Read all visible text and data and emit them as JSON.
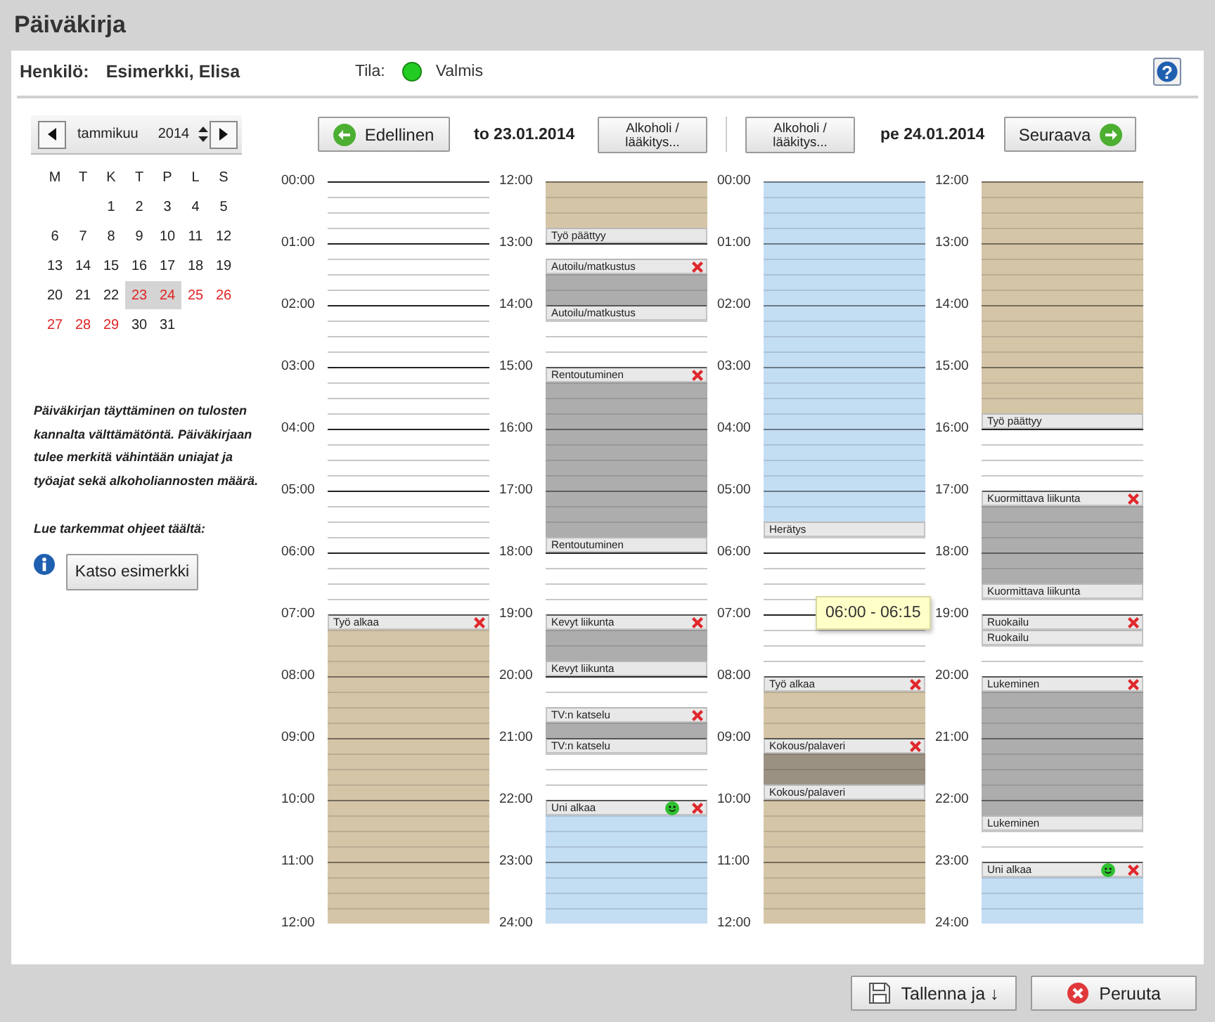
{
  "window": {
    "title": "Päiväkirja"
  },
  "header": {
    "person_label": "Henkilö:",
    "person": "Esimerkki, Elisa",
    "status": {
      "label": "Tila:",
      "color": "#22cc22",
      "value": "Valmis"
    },
    "help": "?"
  },
  "month_picker": {
    "month": "tammikuu",
    "year": "2014"
  },
  "calendar": {
    "weekdays": [
      "M",
      "T",
      "K",
      "T",
      "P",
      "L",
      "S"
    ],
    "weeks": [
      [
        {
          "day": "1",
          "selected": false,
          "marked": false
        },
        {
          "day": "2",
          "selected": false,
          "marked": false
        },
        {
          "day": "3",
          "selected": false,
          "marked": false
        },
        {
          "day": "4",
          "selected": false,
          "marked": false
        },
        {
          "day": "5",
          "selected": false,
          "marked": false
        }
      ],
      [
        {
          "day": "6",
          "selected": false,
          "marked": false
        },
        {
          "day": "7",
          "selected": false,
          "marked": false
        },
        {
          "day": "8",
          "selected": false,
          "marked": false
        },
        {
          "day": "9",
          "selected": false,
          "marked": false
        },
        {
          "day": "10",
          "selected": false,
          "marked": false
        },
        {
          "day": "11",
          "selected": false,
          "marked": false
        },
        {
          "day": "12",
          "selected": false,
          "marked": false
        }
      ],
      [
        {
          "day": "13",
          "selected": false,
          "marked": false
        },
        {
          "day": "14",
          "selected": false,
          "marked": false
        },
        {
          "day": "15",
          "selected": false,
          "marked": false
        },
        {
          "day": "16",
          "selected": false,
          "marked": false
        },
        {
          "day": "17",
          "selected": false,
          "marked": false
        },
        {
          "day": "18",
          "selected": false,
          "marked": false
        },
        {
          "day": "19",
          "selected": false,
          "marked": false
        }
      ],
      [
        {
          "day": "20",
          "selected": false,
          "marked": false
        },
        {
          "day": "21",
          "selected": false,
          "marked": false
        },
        {
          "day": "22",
          "selected": false,
          "marked": false
        },
        {
          "day": "23",
          "selected": true,
          "marked": true
        },
        {
          "day": "24",
          "selected": true,
          "marked": true
        },
        {
          "day": "25",
          "selected": false,
          "marked": true
        },
        {
          "day": "26",
          "selected": false,
          "marked": true
        }
      ],
      [
        {
          "day": "27",
          "selected": false,
          "marked": true
        },
        {
          "day": "28",
          "selected": false,
          "marked": true
        },
        {
          "day": "29",
          "selected": false,
          "marked": true
        },
        {
          "day": "30",
          "selected": false,
          "marked": false
        },
        {
          "day": "31",
          "selected": false,
          "marked": false
        }
      ]
    ]
  },
  "instructions": {
    "text": "Päiväkirjan täyttäminen on tulosten kannalta välttämätöntä. Päiväkirjaan tulee merkitä vähintään uniajat ja työajat sekä alkoholiannosten määrä.",
    "link_prompt": "Lue tarkemmat ohjeet täältä:",
    "example_button": "Katso esimerkki"
  },
  "nav": {
    "prev": "Edellinen",
    "next": "Seuraava"
  },
  "days": [
    {
      "date": "to 23.01.2014",
      "alcohol_button": "Alkoholi / lääkitys...",
      "columns": [
        {
          "hours": [
            "00:00",
            "01:00",
            "02:00",
            "03:00",
            "04:00",
            "05:00",
            "06:00",
            "07:00",
            "08:00",
            "09:00",
            "10:00",
            "11:00",
            "12:00"
          ],
          "slots": [
            {
              "kind": "empty"
            },
            {
              "kind": "empty"
            },
            {
              "kind": "empty"
            },
            {
              "kind": "empty"
            },
            {
              "kind": "empty"
            },
            {
              "kind": "empty"
            },
            {
              "kind": "empty"
            },
            {
              "kind": "empty"
            },
            {
              "kind": "empty"
            },
            {
              "kind": "empty"
            },
            {
              "kind": "empty"
            },
            {
              "kind": "empty"
            },
            {
              "kind": "empty"
            },
            {
              "kind": "empty"
            },
            {
              "kind": "empty"
            },
            {
              "kind": "empty"
            },
            {
              "kind": "empty"
            },
            {
              "kind": "empty"
            },
            {
              "kind": "empty"
            },
            {
              "kind": "empty"
            },
            {
              "kind": "empty"
            },
            {
              "kind": "empty"
            },
            {
              "kind": "empty"
            },
            {
              "kind": "empty"
            },
            {
              "kind": "empty"
            },
            {
              "kind": "empty"
            },
            {
              "kind": "empty"
            },
            {
              "kind": "empty"
            },
            {
              "kind": "label",
              "text": "Työ alkaa",
              "delete": true,
              "smiley": false
            },
            {
              "kind": "fill",
              "color": "#d5c5a7"
            },
            {
              "kind": "fill",
              "color": "#d5c5a7"
            },
            {
              "kind": "fill",
              "color": "#d5c5a7"
            },
            {
              "kind": "fill",
              "color": "#d5c5a7"
            },
            {
              "kind": "fill",
              "color": "#d5c5a7"
            },
            {
              "kind": "fill",
              "color": "#d5c5a7"
            },
            {
              "kind": "fill",
              "color": "#d5c5a7"
            },
            {
              "kind": "fill",
              "color": "#d5c5a7"
            },
            {
              "kind": "fill",
              "color": "#d5c5a7"
            },
            {
              "kind": "fill",
              "color": "#d5c5a7"
            },
            {
              "kind": "fill",
              "color": "#d5c5a7"
            },
            {
              "kind": "fill",
              "color": "#d5c5a7"
            },
            {
              "kind": "fill",
              "color": "#d5c5a7"
            },
            {
              "kind": "fill",
              "color": "#d5c5a7"
            },
            {
              "kind": "fill",
              "color": "#d5c5a7"
            },
            {
              "kind": "fill",
              "color": "#d5c5a7"
            },
            {
              "kind": "fill",
              "color": "#d5c5a7"
            },
            {
              "kind": "fill",
              "color": "#d5c5a7"
            },
            {
              "kind": "fill",
              "color": "#d5c5a7"
            }
          ]
        },
        {
          "hours": [
            "12:00",
            "13:00",
            "14:00",
            "15:00",
            "16:00",
            "17:00",
            "18:00",
            "19:00",
            "20:00",
            "21:00",
            "22:00",
            "23:00",
            "24:00"
          ],
          "slots": [
            {
              "kind": "fill",
              "color": "#d5c5a7"
            },
            {
              "kind": "fill",
              "color": "#d5c5a7"
            },
            {
              "kind": "fill",
              "color": "#d5c5a7"
            },
            {
              "kind": "label",
              "text": "Työ päättyy",
              "delete": false,
              "smiley": false
            },
            {
              "kind": "empty"
            },
            {
              "kind": "label",
              "text": "Autoilu/matkustus",
              "delete": true,
              "smiley": false
            },
            {
              "kind": "fill",
              "color": "#adadad"
            },
            {
              "kind": "fill",
              "color": "#adadad"
            },
            {
              "kind": "label",
              "text": "Autoilu/matkustus",
              "delete": false,
              "smiley": false
            },
            {
              "kind": "empty"
            },
            {
              "kind": "empty"
            },
            {
              "kind": "empty"
            },
            {
              "kind": "label",
              "text": "Rentoutuminen",
              "delete": true,
              "smiley": false
            },
            {
              "kind": "fill",
              "color": "#adadad"
            },
            {
              "kind": "fill",
              "color": "#adadad"
            },
            {
              "kind": "fill",
              "color": "#adadad"
            },
            {
              "kind": "fill",
              "color": "#adadad"
            },
            {
              "kind": "fill",
              "color": "#adadad"
            },
            {
              "kind": "fill",
              "color": "#adadad"
            },
            {
              "kind": "fill",
              "color": "#adadad"
            },
            {
              "kind": "fill",
              "color": "#adadad"
            },
            {
              "kind": "fill",
              "color": "#adadad"
            },
            {
              "kind": "fill",
              "color": "#adadad"
            },
            {
              "kind": "label",
              "text": "Rentoutuminen",
              "delete": false,
              "smiley": false
            },
            {
              "kind": "empty"
            },
            {
              "kind": "empty"
            },
            {
              "kind": "empty"
            },
            {
              "kind": "empty"
            },
            {
              "kind": "label",
              "text": "Kevyt liikunta",
              "delete": true,
              "smiley": false
            },
            {
              "kind": "fill",
              "color": "#adadad"
            },
            {
              "kind": "fill",
              "color": "#adadad"
            },
            {
              "kind": "label",
              "text": "Kevyt liikunta",
              "delete": false,
              "smiley": false
            },
            {
              "kind": "empty"
            },
            {
              "kind": "empty"
            },
            {
              "kind": "label",
              "text": "TV:n katselu",
              "delete": true,
              "smiley": false
            },
            {
              "kind": "fill",
              "color": "#adadad"
            },
            {
              "kind": "label",
              "text": "TV:n katselu",
              "delete": false,
              "smiley": false
            },
            {
              "kind": "empty"
            },
            {
              "kind": "empty"
            },
            {
              "kind": "empty"
            },
            {
              "kind": "label",
              "text": "Uni alkaa",
              "delete": true,
              "smiley": true
            },
            {
              "kind": "fill",
              "color": "#c3ddf3"
            },
            {
              "kind": "fill",
              "color": "#c3ddf3"
            },
            {
              "kind": "fill",
              "color": "#c3ddf3"
            },
            {
              "kind": "fill",
              "color": "#c3ddf3"
            },
            {
              "kind": "fill",
              "color": "#c3ddf3"
            },
            {
              "kind": "fill",
              "color": "#c3ddf3"
            },
            {
              "kind": "fill",
              "color": "#c3ddf3"
            }
          ]
        }
      ]
    },
    {
      "date": "pe 24.01.2014",
      "alcohol_button": "Alkoholi / lääkitys...",
      "columns": [
        {
          "hours": [
            "00:00",
            "01:00",
            "02:00",
            "03:00",
            "04:00",
            "05:00",
            "06:00",
            "07:00",
            "08:00",
            "09:00",
            "10:00",
            "11:00",
            "12:00"
          ],
          "slots": [
            {
              "kind": "fill",
              "color": "#c3ddf3"
            },
            {
              "kind": "fill",
              "color": "#c3ddf3"
            },
            {
              "kind": "fill",
              "color": "#c3ddf3"
            },
            {
              "kind": "fill",
              "color": "#c3ddf3"
            },
            {
              "kind": "fill",
              "color": "#c3ddf3"
            },
            {
              "kind": "fill",
              "color": "#c3ddf3"
            },
            {
              "kind": "fill",
              "color": "#c3ddf3"
            },
            {
              "kind": "fill",
              "color": "#c3ddf3"
            },
            {
              "kind": "fill",
              "color": "#c3ddf3"
            },
            {
              "kind": "fill",
              "color": "#c3ddf3"
            },
            {
              "kind": "fill",
              "color": "#c3ddf3"
            },
            {
              "kind": "fill",
              "color": "#c3ddf3"
            },
            {
              "kind": "fill",
              "color": "#c3ddf3"
            },
            {
              "kind": "fill",
              "color": "#c3ddf3"
            },
            {
              "kind": "fill",
              "color": "#c3ddf3"
            },
            {
              "kind": "fill",
              "color": "#c3ddf3"
            },
            {
              "kind": "fill",
              "color": "#c3ddf3"
            },
            {
              "kind": "fill",
              "color": "#c3ddf3"
            },
            {
              "kind": "fill",
              "color": "#c3ddf3"
            },
            {
              "kind": "fill",
              "color": "#c3ddf3"
            },
            {
              "kind": "fill",
              "color": "#c3ddf3"
            },
            {
              "kind": "fill",
              "color": "#c3ddf3"
            },
            {
              "kind": "label",
              "text": "Herätys",
              "delete": false,
              "smiley": false
            },
            {
              "kind": "empty"
            },
            {
              "kind": "empty"
            },
            {
              "kind": "empty"
            },
            {
              "kind": "empty"
            },
            {
              "kind": "empty"
            },
            {
              "kind": "empty"
            },
            {
              "kind": "empty"
            },
            {
              "kind": "empty"
            },
            {
              "kind": "empty"
            },
            {
              "kind": "label",
              "text": "Työ alkaa",
              "delete": true,
              "smiley": false
            },
            {
              "kind": "fill",
              "color": "#d5c5a7"
            },
            {
              "kind": "fill",
              "color": "#d5c5a7"
            },
            {
              "kind": "fill",
              "color": "#d5c5a7"
            },
            {
              "kind": "label",
              "text": "Kokous/palaveri",
              "delete": true,
              "smiley": false
            },
            {
              "kind": "fill",
              "color": "#9b9183"
            },
            {
              "kind": "fill",
              "color": "#9b9183"
            },
            {
              "kind": "label",
              "text": "Kokous/palaveri",
              "delete": false,
              "smiley": false
            },
            {
              "kind": "fill",
              "color": "#d5c5a7"
            },
            {
              "kind": "fill",
              "color": "#d5c5a7"
            },
            {
              "kind": "fill",
              "color": "#d5c5a7"
            },
            {
              "kind": "fill",
              "color": "#d5c5a7"
            },
            {
              "kind": "fill",
              "color": "#d5c5a7"
            },
            {
              "kind": "fill",
              "color": "#d5c5a7"
            },
            {
              "kind": "fill",
              "color": "#d5c5a7"
            },
            {
              "kind": "fill",
              "color": "#d5c5a7"
            }
          ]
        },
        {
          "hours": [
            "12:00",
            "13:00",
            "14:00",
            "15:00",
            "16:00",
            "17:00",
            "18:00",
            "19:00",
            "20:00",
            "21:00",
            "22:00",
            "23:00",
            "24:00"
          ],
          "slots": [
            {
              "kind": "fill",
              "color": "#d5c5a7"
            },
            {
              "kind": "fill",
              "color": "#d5c5a7"
            },
            {
              "kind": "fill",
              "color": "#d5c5a7"
            },
            {
              "kind": "fill",
              "color": "#d5c5a7"
            },
            {
              "kind": "fill",
              "color": "#d5c5a7"
            },
            {
              "kind": "fill",
              "color": "#d5c5a7"
            },
            {
              "kind": "fill",
              "color": "#d5c5a7"
            },
            {
              "kind": "fill",
              "color": "#d5c5a7"
            },
            {
              "kind": "fill",
              "color": "#d5c5a7"
            },
            {
              "kind": "fill",
              "color": "#d5c5a7"
            },
            {
              "kind": "fill",
              "color": "#d5c5a7"
            },
            {
              "kind": "fill",
              "color": "#d5c5a7"
            },
            {
              "kind": "fill",
              "color": "#d5c5a7"
            },
            {
              "kind": "fill",
              "color": "#d5c5a7"
            },
            {
              "kind": "fill",
              "color": "#d5c5a7"
            },
            {
              "kind": "label",
              "text": "Työ päättyy",
              "delete": false,
              "smiley": false
            },
            {
              "kind": "empty"
            },
            {
              "kind": "empty"
            },
            {
              "kind": "empty"
            },
            {
              "kind": "empty"
            },
            {
              "kind": "label",
              "text": "Kuormittava liikunta",
              "delete": true,
              "smiley": false
            },
            {
              "kind": "fill",
              "color": "#adadad"
            },
            {
              "kind": "fill",
              "color": "#adadad"
            },
            {
              "kind": "fill",
              "color": "#adadad"
            },
            {
              "kind": "fill",
              "color": "#adadad"
            },
            {
              "kind": "fill",
              "color": "#adadad"
            },
            {
              "kind": "label",
              "text": "Kuormittava liikunta",
              "delete": false,
              "smiley": false
            },
            {
              "kind": "empty"
            },
            {
              "kind": "label",
              "text": "Ruokailu",
              "delete": true,
              "smiley": false
            },
            {
              "kind": "label",
              "text": "Ruokailu",
              "delete": false,
              "smiley": false
            },
            {
              "kind": "empty"
            },
            {
              "kind": "empty"
            },
            {
              "kind": "label",
              "text": "Lukeminen",
              "delete": true,
              "smiley": false
            },
            {
              "kind": "fill",
              "color": "#adadad"
            },
            {
              "kind": "fill",
              "color": "#adadad"
            },
            {
              "kind": "fill",
              "color": "#adadad"
            },
            {
              "kind": "fill",
              "color": "#adadad"
            },
            {
              "kind": "fill",
              "color": "#adadad"
            },
            {
              "kind": "fill",
              "color": "#adadad"
            },
            {
              "kind": "fill",
              "color": "#adadad"
            },
            {
              "kind": "fill",
              "color": "#adadad"
            },
            {
              "kind": "label",
              "text": "Lukeminen",
              "delete": false,
              "smiley": false
            },
            {
              "kind": "empty"
            },
            {
              "kind": "empty"
            },
            {
              "kind": "label",
              "text": "Uni alkaa",
              "delete": true,
              "smiley": true
            },
            {
              "kind": "fill",
              "color": "#c3ddf3"
            },
            {
              "kind": "fill",
              "color": "#c3ddf3"
            },
            {
              "kind": "fill",
              "color": "#c3ddf3"
            }
          ]
        }
      ]
    }
  ],
  "tooltip": {
    "text": "06:00 - 06:15"
  },
  "footer": {
    "save": "Tallenna ja ↓",
    "cancel": "Peruuta"
  }
}
